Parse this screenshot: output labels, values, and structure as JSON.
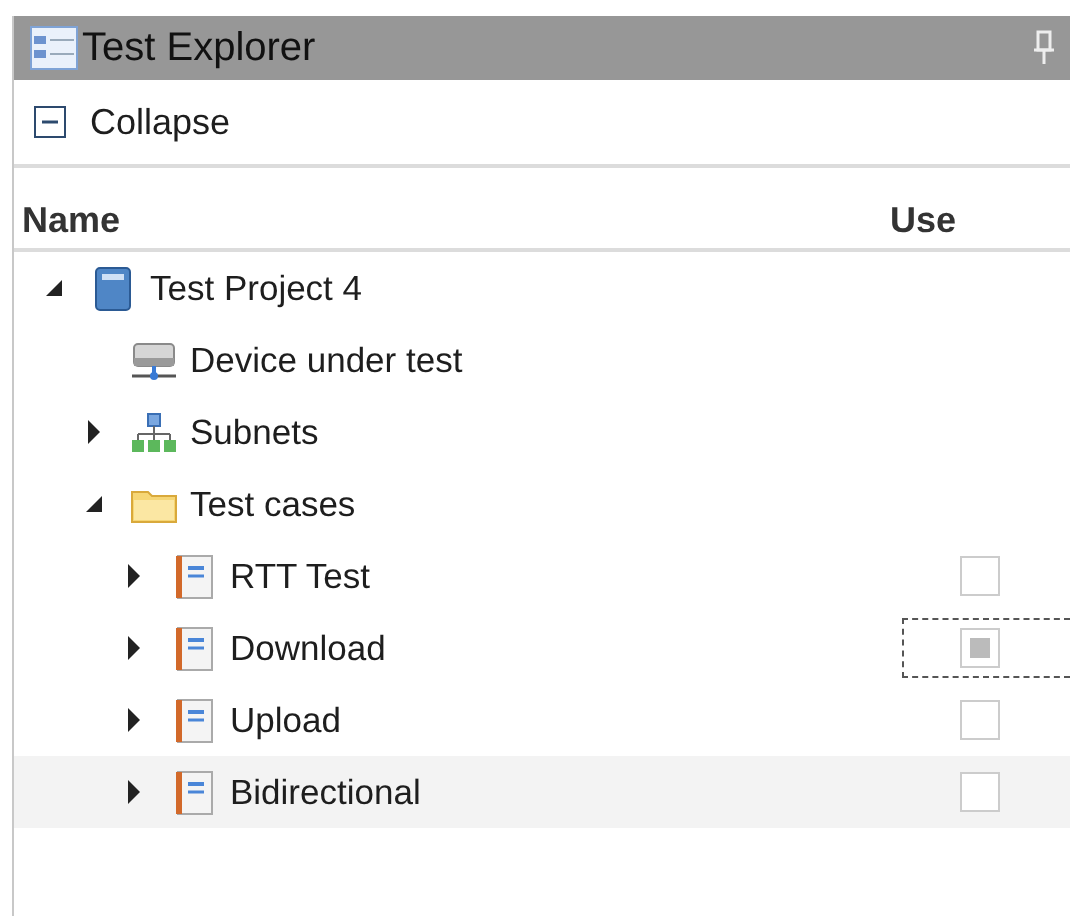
{
  "window": {
    "title": "Test Explorer"
  },
  "toolbar": {
    "collapse_label": "Collapse"
  },
  "columns": [
    "Name",
    "Use"
  ],
  "tree": [
    {
      "kind": "project",
      "label": "Test Project 4",
      "expanded": true,
      "selected": false,
      "children": [
        {
          "kind": "device",
          "label": "Device under test",
          "selected": false
        },
        {
          "kind": "subnets",
          "label": "Subnets",
          "expanded": false,
          "selected": false
        },
        {
          "kind": "folder",
          "label": "Test cases",
          "expanded": true,
          "selected": false,
          "children": [
            {
              "kind": "test",
              "label": "RTT Test",
              "expanded": false,
              "selected": false,
              "checked": false,
              "indeterminate": false,
              "focused": false
            },
            {
              "kind": "test",
              "label": "Download",
              "expanded": false,
              "selected": false,
              "checked": false,
              "indeterminate": true,
              "focused": true
            },
            {
              "kind": "test",
              "label": "Upload",
              "expanded": false,
              "selected": false,
              "checked": false,
              "indeterminate": false,
              "focused": false
            },
            {
              "kind": "test",
              "label": "Bidirectional",
              "expanded": false,
              "selected": true,
              "checked": false,
              "indeterminate": false,
              "focused": false
            }
          ]
        }
      ]
    }
  ]
}
